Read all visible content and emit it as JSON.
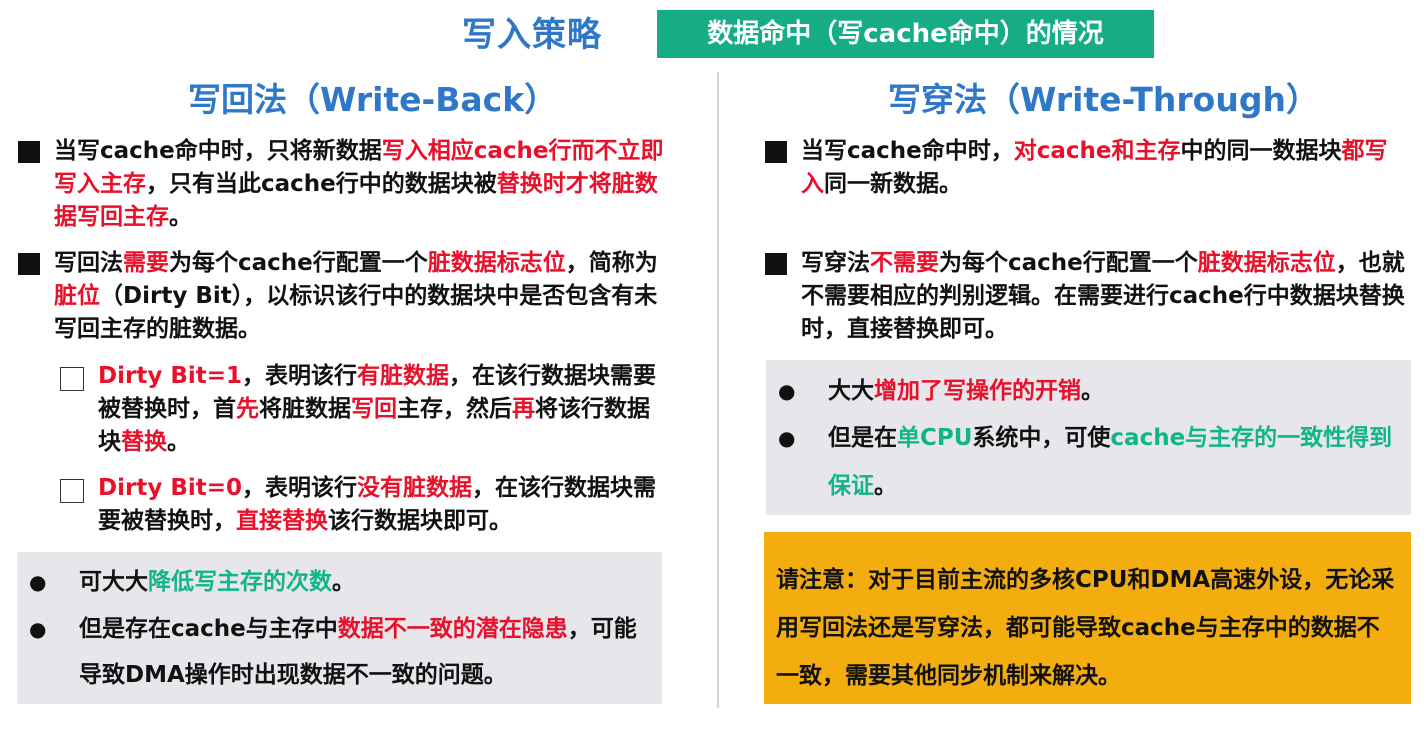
{
  "header": {
    "title": "写入策略",
    "badge": "数据命中（写cache命中）的情况"
  },
  "write_back": {
    "title": "写回法（Write-Back）",
    "p1": {
      "a": "当写cache命中时，只将新数据",
      "b": "写入相应cache行而不立即写入主存",
      "c": "，只有当此cache行中的数据块被",
      "d": "替换时才将脏数据写回主存",
      "e": "。"
    },
    "p2": {
      "a": "写回法",
      "b": "需要",
      "c": "为每个cache行配置一个",
      "d": "脏数据标志位",
      "e": "，简称为",
      "f": "脏位",
      "g": "（Dirty Bit），以标识该行中的数据块中是否包含有未写回主存的脏数据。"
    },
    "s1": {
      "a": "Dirty Bit=1",
      "b": "，表明该行",
      "c": "有脏数据",
      "d": "，在该行数据块需要被替换时，首",
      "e": "先",
      "f": "将脏数据",
      "g": "写回",
      "h": "主存，然后",
      "i": "再",
      "j": "将该行数据块",
      "k": "替换",
      "l": "。"
    },
    "s2": {
      "a": "Dirty Bit=0",
      "b": "，表明该行",
      "c": "没有脏数据",
      "d": "，在该行数据块需要被替换时，",
      "e": "直接替换",
      "f": "该行数据块即可。"
    },
    "pros": {
      "i1a": "可大大",
      "i1b": "降低写主存的次数",
      "i1c": "。",
      "i2a": "但是存在cache与主存中",
      "i2b": "数据不一致的潜在隐患",
      "i2c": "，可能导致DMA操作时出现数据不一致的问题。"
    }
  },
  "write_through": {
    "title": "写穿法（Write-Through）",
    "p1": {
      "a": "当写cache命中时，",
      "b": "对cache和主存",
      "c": "中的同一数据块",
      "d": "都写入",
      "e": "同一新数据。"
    },
    "p2": {
      "a": "写穿法",
      "b": "不需要",
      "c": "为每个cache行配置一个",
      "d": "脏数据标志位",
      "e": "，也就不需要相应的判别逻辑。在需要进行cache行中数据块替换时，直接替换即可。"
    },
    "pros": {
      "i1a": "大大",
      "i1b": "增加了写操作的开销",
      "i1c": "。",
      "i2a": "但是在",
      "i2b": "单CPU",
      "i2c": "系统中，可使",
      "i2d": "cache与主存的一致性得到保证",
      "i2e": "。"
    },
    "note": "请注意：对于目前主流的多核CPU和DMA高速外设，无论采用写回法还是写穿法，都可能导致cache与主存中的数据不一致，需要其他同步机制来解决。"
  },
  "colors": {
    "title_blue": "#2f78c8",
    "accent_red": "#e8102a",
    "accent_teal": "#12b58a",
    "badge_green": "#16ad86",
    "note_orange": "#f4ad0f",
    "box_gray": "#e6e6eb"
  },
  "icons": {
    "bullet": "black-square-bullet",
    "sub_bullet": "empty-checkbox",
    "list_dot": "black-circle-dot"
  }
}
